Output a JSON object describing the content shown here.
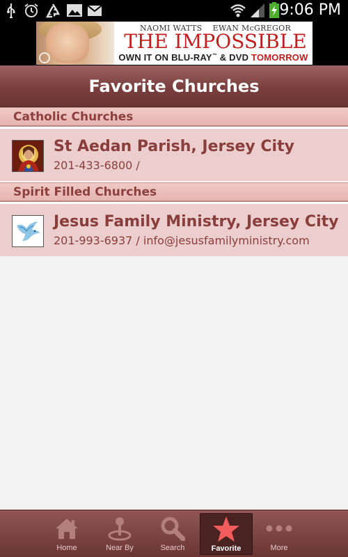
{
  "status_bar": {
    "time": "9:06 PM",
    "icons": [
      "usb-icon",
      "alarm-icon",
      "recycle-icon",
      "image-icon",
      "mail-icon",
      "wifi-icon",
      "signal-icon",
      "battery-charging-icon"
    ]
  },
  "ad": {
    "names": "NAOMI WATTS    EWAN McGREGOR",
    "title": "THE IMPOSSIBLE",
    "subtitle_prefix": "OWN IT ON BLU-RAY",
    "subtitle_tm": "™",
    "subtitle_mid": " & DVD ",
    "subtitle_highlight": "TOMORROW"
  },
  "header": {
    "title": "Favorite Churches"
  },
  "sections": [
    {
      "title": "Catholic Churches",
      "items": [
        {
          "name": "St Aedan Parish, Jersey City",
          "detail": "201-433-6800 /"
        }
      ]
    },
    {
      "title": "Spirit Filled Churches",
      "items": [
        {
          "name": "Jesus Family Ministry, Jersey City",
          "detail": "201-993-6937 / info@jesusfamilyministry.com"
        }
      ]
    }
  ],
  "tabs": [
    {
      "label": "Home",
      "icon": "home-icon"
    },
    {
      "label": "Near By",
      "icon": "map-pin-icon"
    },
    {
      "label": "Search",
      "icon": "search-icon"
    },
    {
      "label": "Favorite",
      "icon": "star-icon",
      "active": true
    },
    {
      "label": "More",
      "icon": "more-icon"
    }
  ],
  "colors": {
    "title_bar": "#7a3f3e",
    "section_header": "#e6b4b1",
    "row_background": "#ebcecd",
    "text_accent": "#8a3e3c",
    "tab_bar": "#6b3534",
    "active_tab_icon": "#f25c5c",
    "ad_title": "#c31d1d"
  }
}
